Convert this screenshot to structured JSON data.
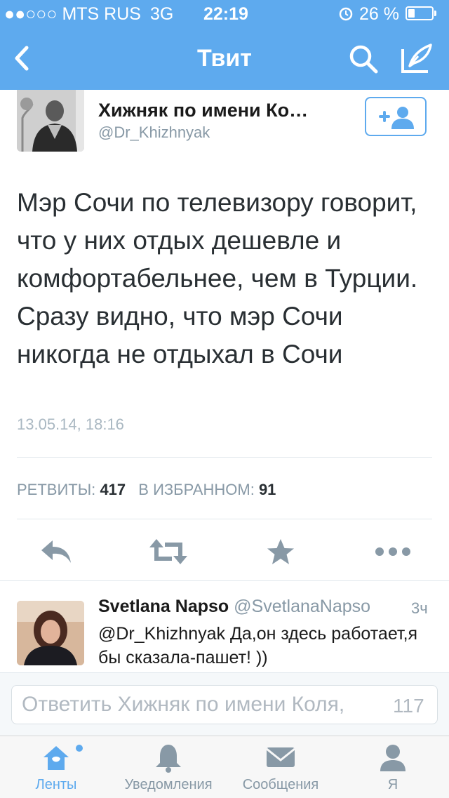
{
  "status_bar": {
    "carrier": "●●○○○ MTS RUS",
    "network": "3G",
    "time": "22:19",
    "battery": "26 %"
  },
  "nav": {
    "title": "Твит",
    "back_icon": "chevron-left-icon",
    "search_icon": "search-icon",
    "compose_icon": "compose-icon"
  },
  "tweet": {
    "author_name": "Хижняк по имени Ко…",
    "author_handle": "@Dr_Khizhnyak",
    "text": "Мэр Сочи по телевизору говорит, что у них отдых дешевле и комфортабельнее, чем в Турции. Сразу видно, что мэр Сочи никогда не отдыхал в Сочи",
    "timestamp": "13.05.14, 18:16",
    "retweets_label": "РЕТВИТЫ:",
    "retweets_count": "417",
    "favorites_label": "В ИЗБРАННОМ:",
    "favorites_count": "91"
  },
  "reply": {
    "name": "Svetlana Napso",
    "handle": "@SvetlanaNapso",
    "time": "3ч",
    "text": "@Dr_Khizhnyak Да,он здесь работает,я бы сказала-пашет! ))"
  },
  "composer": {
    "placeholder": "Ответить Хижняк по имени Коля,",
    "char_count": "117"
  },
  "tabs": [
    {
      "label": "Ленты",
      "icon": "home-icon",
      "active": true
    },
    {
      "label": "Уведомления",
      "icon": "bell-icon",
      "active": false
    },
    {
      "label": "Сообщения",
      "icon": "envelope-icon",
      "active": false
    },
    {
      "label": "Я",
      "icon": "person-icon",
      "active": false
    }
  ],
  "colors": {
    "accent": "#5eaaee",
    "text": "#292f33",
    "muted": "#8899a6"
  }
}
